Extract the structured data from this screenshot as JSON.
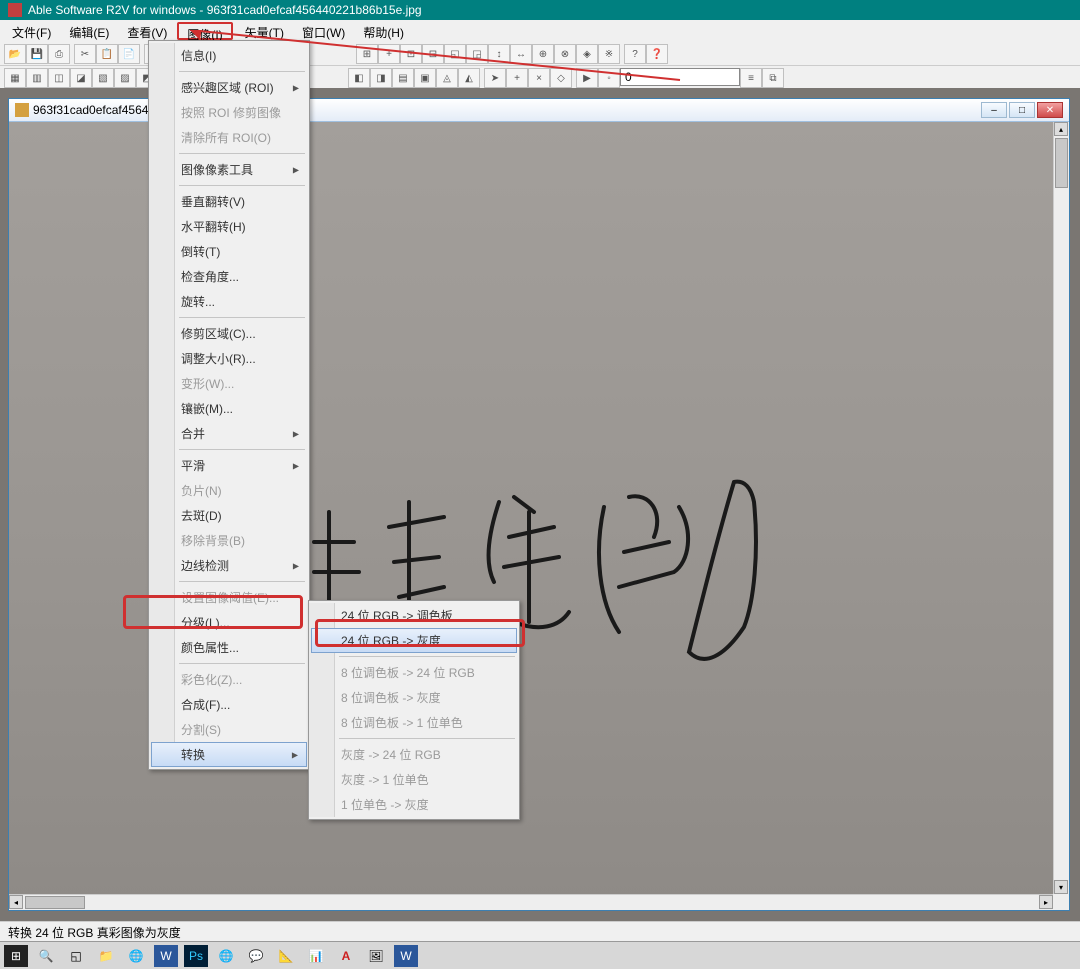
{
  "window": {
    "title": "Able Software R2V for windows - 963f31cad0efcaf456440221b86b15e.jpg"
  },
  "menubar": {
    "items": [
      {
        "label": "文件(F)"
      },
      {
        "label": "编辑(E)"
      },
      {
        "label": "查看(V)"
      },
      {
        "label": "图像(I)"
      },
      {
        "label": "矢量(T)"
      },
      {
        "label": "窗口(W)"
      },
      {
        "label": "帮助(H)"
      }
    ]
  },
  "toolbar2_input": "0",
  "doc": {
    "title": "963f31cad0efcaf4564..."
  },
  "dropdown": {
    "items": [
      {
        "label": "信息(I)",
        "disabled": false,
        "sub": false
      },
      {
        "sep": true
      },
      {
        "label": "感兴趣区域 (ROI)",
        "disabled": false,
        "sub": true
      },
      {
        "label": "按照 ROI 修剪图像",
        "disabled": true,
        "sub": false
      },
      {
        "label": "清除所有 ROI(O)",
        "disabled": true,
        "sub": false
      },
      {
        "sep": true
      },
      {
        "label": "图像像素工具",
        "disabled": false,
        "sub": true
      },
      {
        "sep": true
      },
      {
        "label": "垂直翻转(V)",
        "disabled": false,
        "sub": false
      },
      {
        "label": "水平翻转(H)",
        "disabled": false,
        "sub": false
      },
      {
        "label": "倒转(T)",
        "disabled": false,
        "sub": false
      },
      {
        "label": "检查角度...",
        "disabled": false,
        "sub": false
      },
      {
        "label": "旋转...",
        "disabled": false,
        "sub": false
      },
      {
        "sep": true
      },
      {
        "label": "修剪区域(C)...",
        "disabled": false,
        "sub": false
      },
      {
        "label": "调整大小(R)...",
        "disabled": false,
        "sub": false
      },
      {
        "label": "变形(W)...",
        "disabled": true,
        "sub": false
      },
      {
        "label": "镶嵌(M)...",
        "disabled": false,
        "sub": false
      },
      {
        "label": "合并",
        "disabled": false,
        "sub": true
      },
      {
        "sep": true
      },
      {
        "label": "平滑",
        "disabled": false,
        "sub": true
      },
      {
        "label": "负片(N)",
        "disabled": true,
        "sub": false
      },
      {
        "label": "去斑(D)",
        "disabled": false,
        "sub": false
      },
      {
        "label": "移除背景(B)",
        "disabled": true,
        "sub": false
      },
      {
        "label": "边线检测",
        "disabled": false,
        "sub": true
      },
      {
        "sep": true
      },
      {
        "label": "设置图像阈值(E)...",
        "disabled": true,
        "sub": false
      },
      {
        "label": "分级(L)...",
        "disabled": false,
        "sub": false
      },
      {
        "label": "颜色属性...",
        "disabled": false,
        "sub": false
      },
      {
        "sep": true
      },
      {
        "label": "彩色化(Z)...",
        "disabled": true,
        "sub": false
      },
      {
        "label": "合成(F)...",
        "disabled": false,
        "sub": false
      },
      {
        "label": "分割(S)",
        "disabled": true,
        "sub": false
      },
      {
        "label": "转换",
        "disabled": false,
        "sub": true,
        "hover": true
      }
    ]
  },
  "submenu": {
    "items": [
      {
        "label": "24 位 RGB -> 调色板",
        "disabled": false,
        "hover": false
      },
      {
        "label": "24 位 RGB -> 灰度",
        "disabled": false,
        "hover": true
      },
      {
        "sep": true
      },
      {
        "label": "8 位调色板 -> 24 位 RGB",
        "disabled": true
      },
      {
        "label": "8 位调色板 -> 灰度",
        "disabled": true
      },
      {
        "label": "8 位调色板 -> 1 位单色",
        "disabled": true
      },
      {
        "sep": true
      },
      {
        "label": "灰度 -> 24 位 RGB",
        "disabled": true
      },
      {
        "label": "灰度 -> 1 位单色",
        "disabled": true
      },
      {
        "label": "1 位单色 -> 灰度",
        "disabled": true
      }
    ]
  },
  "status": "转换 24 位 RGB 真彩图像为灰度",
  "icons": {
    "minimize": "—",
    "maximize": "□",
    "close": "✕",
    "dash": "–"
  }
}
